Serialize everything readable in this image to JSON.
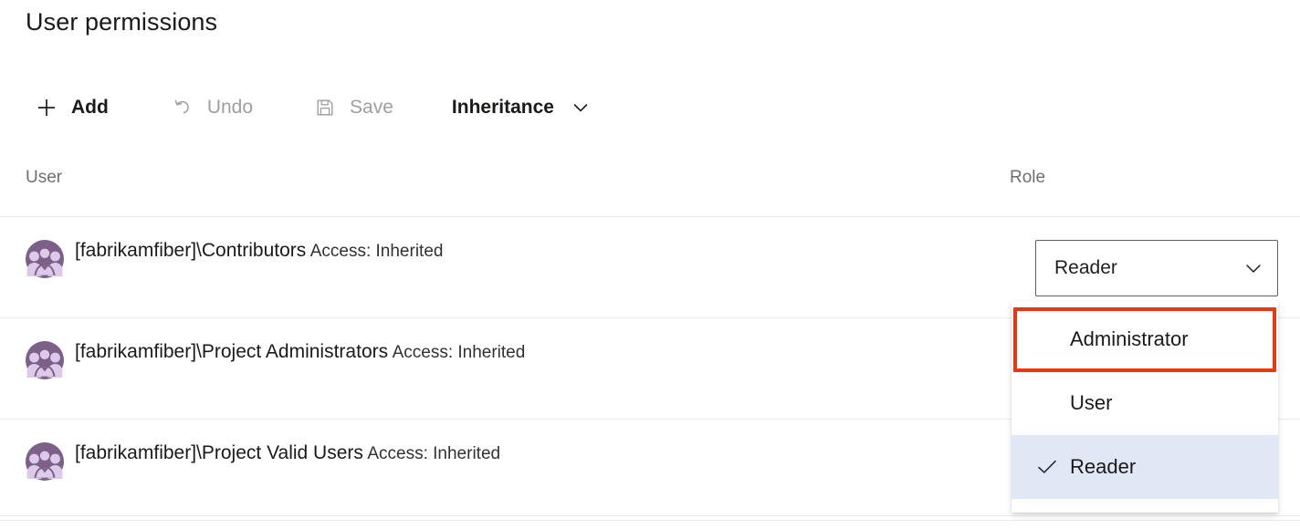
{
  "page": {
    "title": "User permissions"
  },
  "toolbar": {
    "items": [
      {
        "id": "add",
        "label": "Add",
        "icon": "plus-icon",
        "state": "enabled"
      },
      {
        "id": "undo",
        "label": "Undo",
        "icon": "undo-icon",
        "state": "disabled"
      },
      {
        "id": "save",
        "label": "Save",
        "icon": "save-floppy-icon",
        "state": "disabled"
      },
      {
        "id": "inheritance",
        "label": "Inheritance",
        "icon": "chevron-down-icon",
        "state": "menu"
      }
    ]
  },
  "table": {
    "columns": {
      "user": "User",
      "role": "Role"
    },
    "rows": [
      {
        "name": "[fabrikamfiber]\\Contributors",
        "access": "Access: Inherited",
        "avatar_icon": "group-avatar-icon",
        "role": "Reader"
      },
      {
        "name": "[fabrikamfiber]\\Project Administrators",
        "access": "Access: Inherited",
        "avatar_icon": "group-avatar-icon",
        "role": ""
      },
      {
        "name": "[fabrikamfiber]\\Project Valid Users",
        "access": "Access: Inherited",
        "avatar_icon": "group-avatar-icon",
        "role": ""
      }
    ]
  },
  "role_dropdown": {
    "selected_value": "Reader",
    "expanded": true,
    "chevron_icon": "chevron-down-icon",
    "options": [
      {
        "label": "Administrator",
        "checked": false,
        "highlighted": true
      },
      {
        "label": "User",
        "checked": false,
        "highlighted": false
      },
      {
        "label": "Reader",
        "checked": true,
        "highlighted": false
      }
    ]
  },
  "annotation": {
    "target": "Administrator",
    "color": "#e8380d"
  },
  "colors": {
    "avatar_circle": "#7d6088",
    "avatar_figure": "#ddc9e9",
    "selected_row_bg": "#dfe8f4",
    "divider": "#edebe9",
    "disabled_text": "#a19f9d",
    "header_text": "#6e6e6e",
    "annotation_red": "#e8380d"
  }
}
